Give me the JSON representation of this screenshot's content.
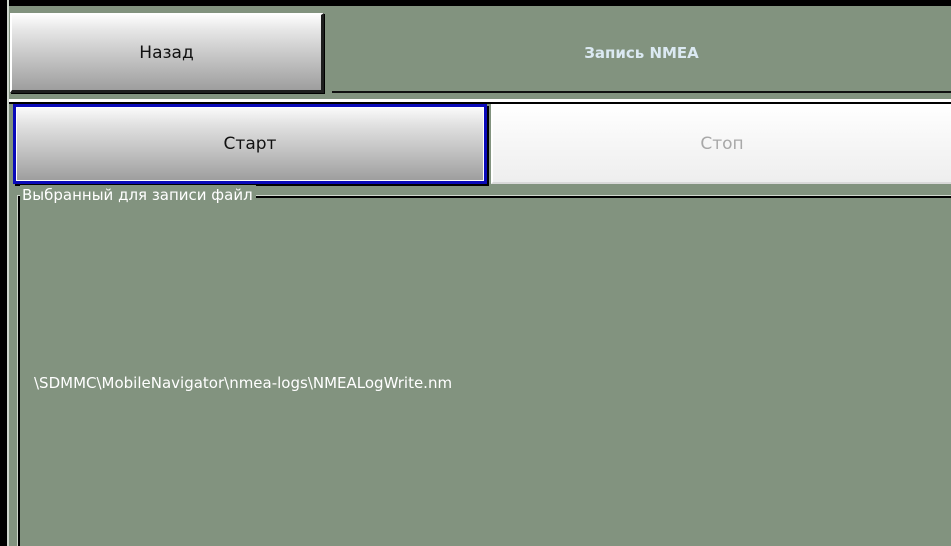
{
  "header": {
    "back_label": "Назад",
    "title": "Запись NMEA"
  },
  "controls": {
    "start_label": "Старт",
    "stop_label": "Стоп",
    "start_focused": true,
    "stop_enabled": false
  },
  "file_group": {
    "legend": "Выбранный для записи файл",
    "path": "\\SDMMC\\MobileNavigator\\nmea-logs\\NMEALogWrite.nm"
  },
  "colors": {
    "background": "#82937f",
    "title_text": "#dbe9f2",
    "focus_border": "#0a0ab9",
    "disabled_text": "#a8a8a8"
  }
}
